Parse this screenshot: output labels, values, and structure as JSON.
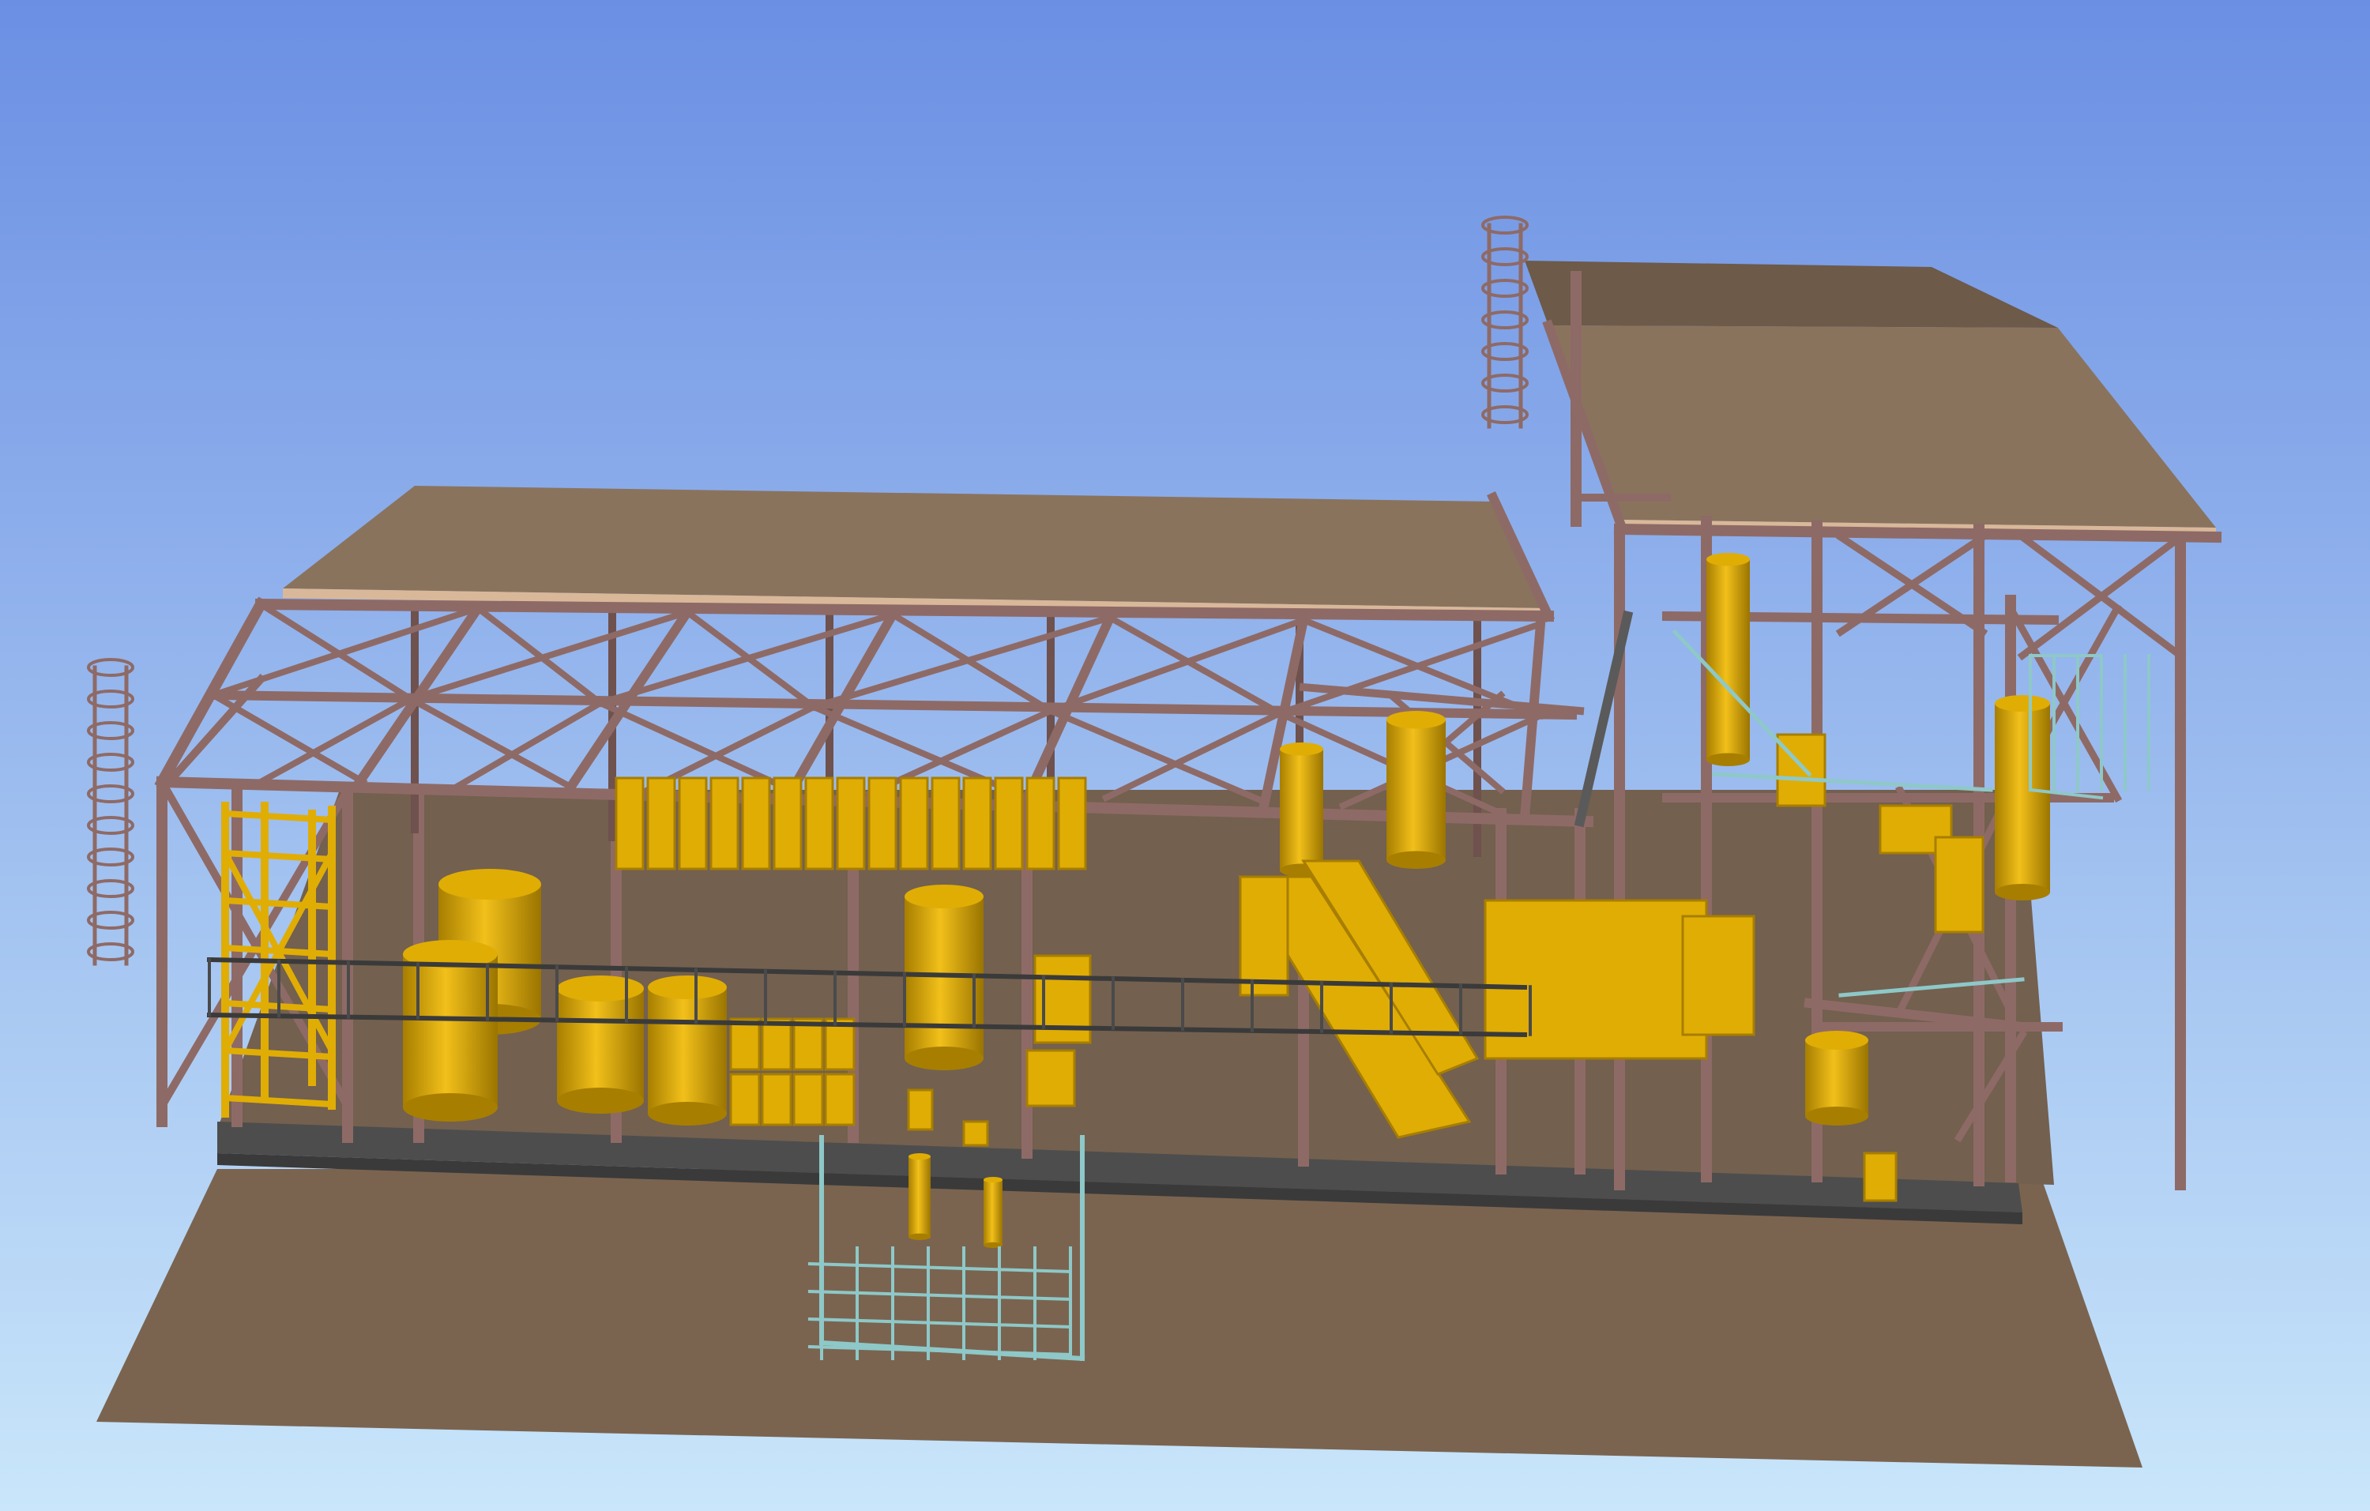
{
  "scene": {
    "kind": "3d-industrial-plant-model",
    "colors": {
      "sky_top": "#6b8fe3",
      "sky_bottom": "#c9e6fa",
      "ground": "#7a6450",
      "roof": "#8a735d",
      "roof_top": "#6d5a49",
      "roof_edge": "#d9b89a",
      "steel": "#8e6a66",
      "steel_dark": "#6f514e",
      "equipment": "#e0ad05",
      "equipment_shade": "#a77e00",
      "railing": "#8ec8c8",
      "foundation": "#4d4d4d"
    }
  }
}
